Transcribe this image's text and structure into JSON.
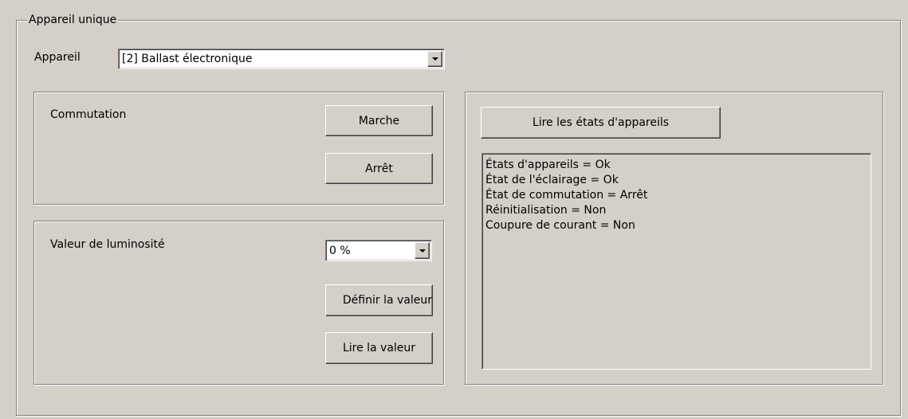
{
  "group": {
    "title": "Appareil unique"
  },
  "device": {
    "label": "Appareil",
    "selected": "[2] Ballast électronique"
  },
  "switching": {
    "label": "Commutation",
    "on_button": "Marche",
    "off_button": "Arrêt"
  },
  "brightness": {
    "label": "Valeur de luminosité",
    "selected": "0 %",
    "set_button": "Définir la valeur",
    "read_button": "Lire la valeur"
  },
  "status": {
    "read_button": "Lire les états d'appareils",
    "lines": [
      "États d'appareils = Ok",
      "État de l'éclairage = Ok",
      "État de commutation = Arrêt",
      "Réinitialisation = Non",
      "Coupure de courant = Non"
    ]
  }
}
